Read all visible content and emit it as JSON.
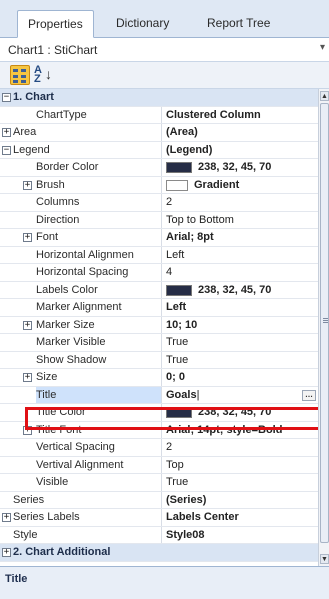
{
  "tabs": [
    {
      "label": "Properties",
      "active": true
    },
    {
      "label": "Dictionary",
      "active": false
    },
    {
      "label": "Report Tree",
      "active": false
    }
  ],
  "object_selector": {
    "value": "Chart1 : StiChart"
  },
  "toolbar": {
    "categorized_icon": "categorized-icon",
    "sort_icon": "sort-az-icon",
    "sort_label": "A Z"
  },
  "colors": {
    "title_color_swatch": "#262D46",
    "highlight": "#E01015"
  },
  "rows": [
    {
      "id": "cat-chart",
      "type": "category",
      "name": "1. Chart",
      "expand": "−"
    },
    {
      "id": "charttype",
      "name": "ChartType",
      "value": "Clustered Column",
      "bold": true
    },
    {
      "id": "area",
      "name": "Area",
      "value": "(Area)",
      "bold": true,
      "expand": "+",
      "top": true
    },
    {
      "id": "legend",
      "name": "Legend",
      "value": "(Legend)",
      "bold": true,
      "expand": "−",
      "top": true
    },
    {
      "id": "border-color",
      "name": "Border Color",
      "value": "238, 32, 45, 70",
      "bold": true,
      "swatch": "#262D46"
    },
    {
      "id": "brush",
      "name": "Brush",
      "value": "Gradient",
      "bold": true,
      "swatch": "white",
      "expand": "+"
    },
    {
      "id": "columns",
      "name": "Columns",
      "value": "2"
    },
    {
      "id": "direction",
      "name": "Direction",
      "value": "Top to Bottom"
    },
    {
      "id": "font",
      "name": "Font",
      "value": "Arial; 8pt",
      "bold": true,
      "expand": "+"
    },
    {
      "id": "horizontal-alignment",
      "name": "Horizontal Alignmen",
      "value": "Left"
    },
    {
      "id": "horizontal-spacing",
      "name": "Horizontal Spacing",
      "value": "4"
    },
    {
      "id": "labels-color",
      "name": "Labels Color",
      "value": "238, 32, 45, 70",
      "bold": true,
      "swatch": "#262D46"
    },
    {
      "id": "marker-alignment",
      "name": "Marker Alignment",
      "value": "Left",
      "bold": true
    },
    {
      "id": "marker-size",
      "name": "Marker Size",
      "value": "10; 10",
      "bold": true,
      "expand": "+"
    },
    {
      "id": "marker-visible",
      "name": "Marker Visible",
      "value": "True"
    },
    {
      "id": "show-shadow",
      "name": "Show Shadow",
      "value": "True"
    },
    {
      "id": "size",
      "name": "Size",
      "value": "0; 0",
      "bold": true,
      "expand": "+"
    },
    {
      "id": "title",
      "name": "Title",
      "value": "Goals",
      "bold": true,
      "selected": true,
      "editing": true
    },
    {
      "id": "title-color",
      "name": "Title Color",
      "value": "238, 32, 45, 70",
      "bold": true,
      "swatch": "#262D46"
    },
    {
      "id": "title-font",
      "name": "Title Font",
      "value": "Arial; 14pt; style=Bold",
      "bold": true,
      "expand": "+"
    },
    {
      "id": "vertical-spacing",
      "name": "Vertical Spacing",
      "value": "2"
    },
    {
      "id": "vertical-alignment",
      "name": "Vertival Alignment",
      "value": "Top"
    },
    {
      "id": "visible",
      "name": "Visible",
      "value": "True"
    },
    {
      "id": "series",
      "name": "Series",
      "value": "(Series)",
      "bold": true,
      "top": true
    },
    {
      "id": "series-labels",
      "name": "Series Labels",
      "value": "Labels Center",
      "bold": true,
      "expand": "+",
      "top": true
    },
    {
      "id": "style",
      "name": "Style",
      "value": "Style08",
      "bold": true,
      "top": true
    },
    {
      "id": "cat-chart-additional",
      "type": "category",
      "name": "2. Chart Additional",
      "expand": "+"
    }
  ],
  "description": {
    "title": "Title"
  }
}
